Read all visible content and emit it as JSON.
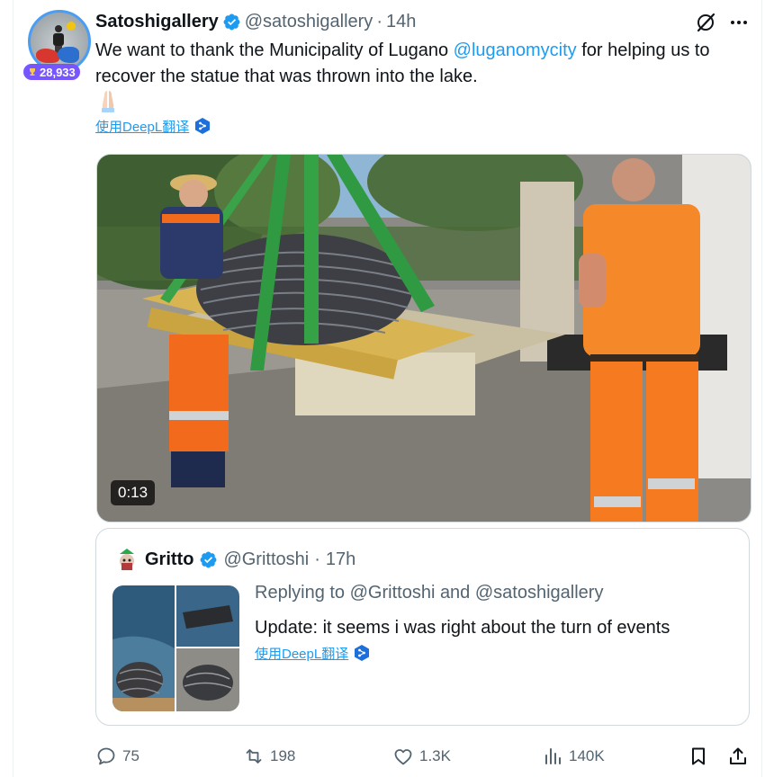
{
  "author": {
    "display_name": "Satoshigallery",
    "handle": "@satoshigallery",
    "separator": "·",
    "time_ago": "14h",
    "badge_count": "28,933",
    "verified": true
  },
  "tweet": {
    "text_before": "We want to thank the Municipality of Lugano ",
    "mention": "@luganomycity",
    "text_after": " for helping us to recover the statue that was thrown into the lake.",
    "emoji": "folded-hands",
    "translate_label": "使用DeepL翻译"
  },
  "media": {
    "type": "video",
    "duration": "0:13"
  },
  "quoted_tweet": {
    "display_name": "Gritto",
    "handle": "@Grittoshi",
    "separator": "·",
    "time_ago": "17h",
    "reply_to": "Replying to @Grittoshi and @satoshigallery",
    "text": "Update: it seems i was right about the turn of events",
    "translate_label": "使用DeepL翻译",
    "verified": true
  },
  "actions": {
    "replies": "75",
    "reposts": "198",
    "likes": "1.3K",
    "views": "140K"
  },
  "colors": {
    "accent": "#1d9bf0",
    "secondary_text": "#536471",
    "badge": "#7856ff",
    "border": "#cfd9de"
  },
  "icons": [
    "verified-badge-icon",
    "grok-icon",
    "more-icon",
    "deepl-icon",
    "reply-icon",
    "repost-icon",
    "like-icon",
    "views-icon",
    "bookmark-icon",
    "share-icon",
    "trophy-icon"
  ]
}
